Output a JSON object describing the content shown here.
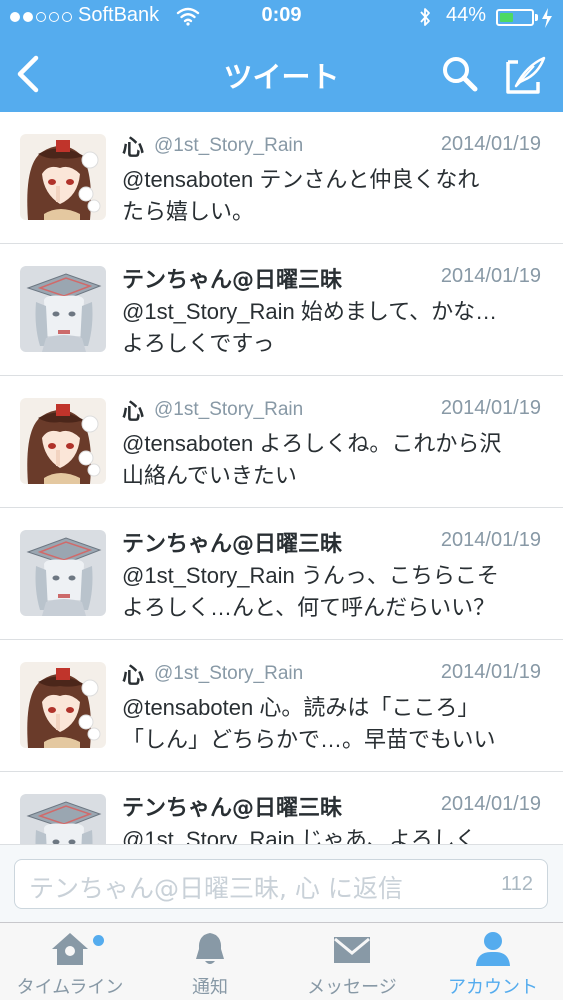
{
  "status_bar": {
    "carrier": "SoftBank",
    "time": "0:09",
    "battery_percent": "44%",
    "battery_level": 0.44,
    "signal_bars_filled": 2,
    "signal_bars_total": 5
  },
  "nav": {
    "title": "ツイート",
    "back_icon": "chevron-left-icon",
    "search_icon": "search-icon",
    "compose_icon": "compose-icon"
  },
  "tweets": [
    {
      "name": "心",
      "handle": "@1st_Story_Rain",
      "date": "2014/01/19",
      "lines": [
        "@tensaboten テンさんと仲良くなれ",
        "たら嬉しい。"
      ],
      "avatar": "kokoro"
    },
    {
      "name": "テンちゃん@日曜三昧",
      "handle": "",
      "date": "2014/01/19",
      "lines": [
        "@1st_Story_Rain 始めまして、かな…",
        "よろしくですっ"
      ],
      "avatar": "ten"
    },
    {
      "name": "心",
      "handle": "@1st_Story_Rain",
      "date": "2014/01/19",
      "lines": [
        "@tensaboten よろしくね。これから沢",
        "山絡んでいきたい"
      ],
      "avatar": "kokoro"
    },
    {
      "name": "テンちゃん@日曜三昧",
      "handle": "",
      "date": "2014/01/19",
      "lines": [
        "@1st_Story_Rain うんっ、こちらこそ",
        "よろしく…んと、何て呼んだらいい？"
      ],
      "avatar": "ten"
    },
    {
      "name": "心",
      "handle": "@1st_Story_Rain",
      "date": "2014/01/19",
      "lines": [
        "@tensaboten 心。読みは「こころ」",
        "「しん」どちらかで…。早苗でもいい"
      ],
      "avatar": "kokoro"
    },
    {
      "name": "テンちゃん@日曜三昧",
      "handle": "",
      "date": "2014/01/19",
      "lines": [
        "@1st_Story_Rain じゃあ、よろしく"
      ],
      "avatar": "ten"
    }
  ],
  "reply": {
    "placeholder": "テンちゃん@日曜三昧, 心 に返信",
    "char_count": "112"
  },
  "tabs": [
    {
      "label": "タイムライン",
      "icon": "home-icon",
      "active": false,
      "badge": true
    },
    {
      "label": "通知",
      "icon": "bell-icon",
      "active": false,
      "badge": false
    },
    {
      "label": "メッセージ",
      "icon": "envelope-icon",
      "active": false,
      "badge": false
    },
    {
      "label": "アカウント",
      "icon": "person-icon",
      "active": true,
      "badge": false
    }
  ],
  "colors": {
    "accent": "#55acee",
    "battery": "#4cd964"
  }
}
